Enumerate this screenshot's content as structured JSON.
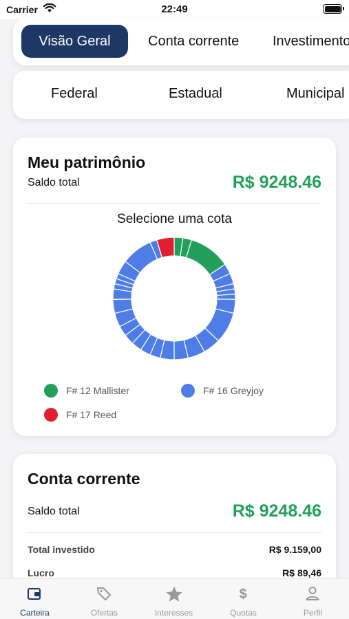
{
  "status_bar": {
    "carrier": "Carrier",
    "time": "22:49"
  },
  "primary_tabs": [
    {
      "label": "Visão Geral",
      "active": true
    },
    {
      "label": "Conta corrente",
      "active": false
    },
    {
      "label": "Investimentos",
      "active": false
    }
  ],
  "secondary_tabs": [
    {
      "label": "Federal"
    },
    {
      "label": "Estadual"
    },
    {
      "label": "Municipal"
    }
  ],
  "patrimonio": {
    "title": "Meu patrimônio",
    "saldo_label": "Saldo total",
    "saldo_value": "R$ 9248.46",
    "chart_title": "Selecione uma cota",
    "legend": [
      {
        "label": "F# 12 Mallister",
        "color": "#22a05b"
      },
      {
        "label": "F# 16 Greyjoy",
        "color": "#4f7de8"
      },
      {
        "label": "F# 17 Reed",
        "color": "#e0202e"
      }
    ]
  },
  "conta_corrente": {
    "title": "Conta corrente",
    "saldo_label": "Saldo total",
    "saldo_value": "R$ 9248.46",
    "rows": [
      {
        "label": "Total investido",
        "value": "R$ 9.159,00"
      },
      {
        "label": "Lucro",
        "value": "R$ 89,46"
      }
    ]
  },
  "tab_bar": [
    {
      "label": "Carteira",
      "icon": "wallet-icon",
      "active": true
    },
    {
      "label": "Ofertas",
      "icon": "tag-icon",
      "active": false
    },
    {
      "label": "Interesses",
      "icon": "star-icon",
      "active": false
    },
    {
      "label": "Quotas",
      "icon": "dollar-icon",
      "active": false
    },
    {
      "label": "Perfil",
      "icon": "person-icon",
      "active": false
    }
  ],
  "chart_data": {
    "type": "pie",
    "title": "Selecione uma cota",
    "series": [
      {
        "name": "F# 12 Mallister",
        "color": "#22a05b",
        "values": [
          2.5,
          2.5,
          12
        ]
      },
      {
        "name": "F# 16 Greyjoy",
        "color": "#4f7de8",
        "values": [
          3,
          3,
          1.5,
          1.5,
          1.5,
          4,
          9,
          5,
          5,
          4,
          4,
          3,
          3,
          3,
          3,
          3,
          4,
          4,
          3,
          1.5,
          1.5,
          1.5,
          4,
          9,
          2
        ]
      },
      {
        "name": "F# 17 Reed",
        "color": "#e0202e",
        "values": [
          5
        ]
      }
    ]
  }
}
